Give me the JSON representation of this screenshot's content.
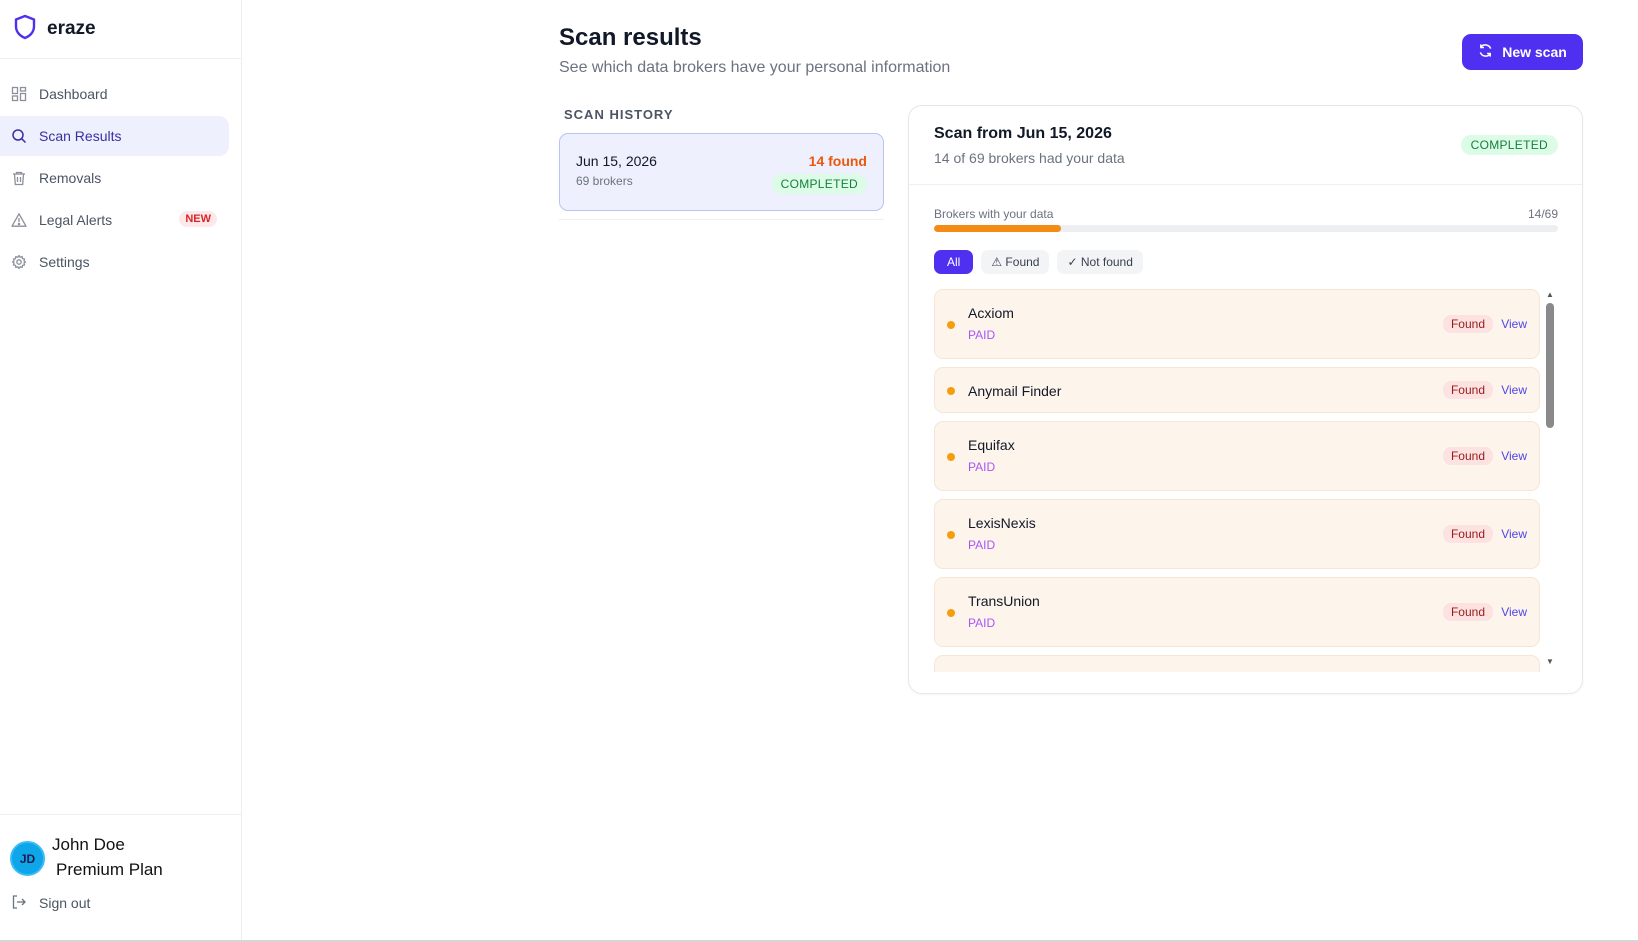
{
  "brand": {
    "name": "eraze"
  },
  "sidebar": {
    "items": [
      {
        "label": "Dashboard",
        "icon": "dashboard-icon"
      },
      {
        "label": "Scan Results",
        "icon": "search-icon",
        "active": true
      },
      {
        "label": "Removals",
        "icon": "trash-icon"
      },
      {
        "label": "Legal Alerts",
        "icon": "alert-triangle-icon",
        "badge": "NEW"
      },
      {
        "label": "Settings",
        "icon": "gear-icon"
      }
    ]
  },
  "user": {
    "initials": "JD",
    "name": "John Doe",
    "plan": "Premium Plan",
    "signout_label": "Sign out"
  },
  "header": {
    "title": "Scan results",
    "subtitle": "See which data brokers have your personal information",
    "new_scan_label": "New scan"
  },
  "history": {
    "label": "SCAN HISTORY",
    "items": [
      {
        "date": "Jun 15, 2026",
        "brokers": "69 brokers",
        "found": "14 found",
        "status": "COMPLETED"
      }
    ]
  },
  "scan": {
    "title": "Scan from Jun 15, 2026",
    "subtitle": "14 of 69 brokers had your data",
    "status": "COMPLETED",
    "progress_label": "Brokers with your data",
    "progress_count": "14/69",
    "progress_fraction": 0.2029
  },
  "filters": [
    {
      "label": "All",
      "active": true
    },
    {
      "label": "⚠ Found"
    },
    {
      "label": "✓ Not found"
    }
  ],
  "brokers": [
    {
      "name": "Acxiom",
      "tag": "PAID",
      "status": "Found",
      "action": "View"
    },
    {
      "name": "Anymail Finder",
      "tag": "",
      "status": "Found",
      "action": "View"
    },
    {
      "name": "Equifax",
      "tag": "PAID",
      "status": "Found",
      "action": "View"
    },
    {
      "name": "LexisNexis",
      "tag": "PAID",
      "status": "Found",
      "action": "View"
    },
    {
      "name": "TransUnion",
      "tag": "PAID",
      "status": "Found",
      "action": "View"
    }
  ],
  "colors": {
    "accent": "#4f2ff0",
    "found_text": "#ea580c",
    "progress": "#f38b15",
    "completed_bg": "#dcfce7",
    "completed_text": "#15803d"
  }
}
